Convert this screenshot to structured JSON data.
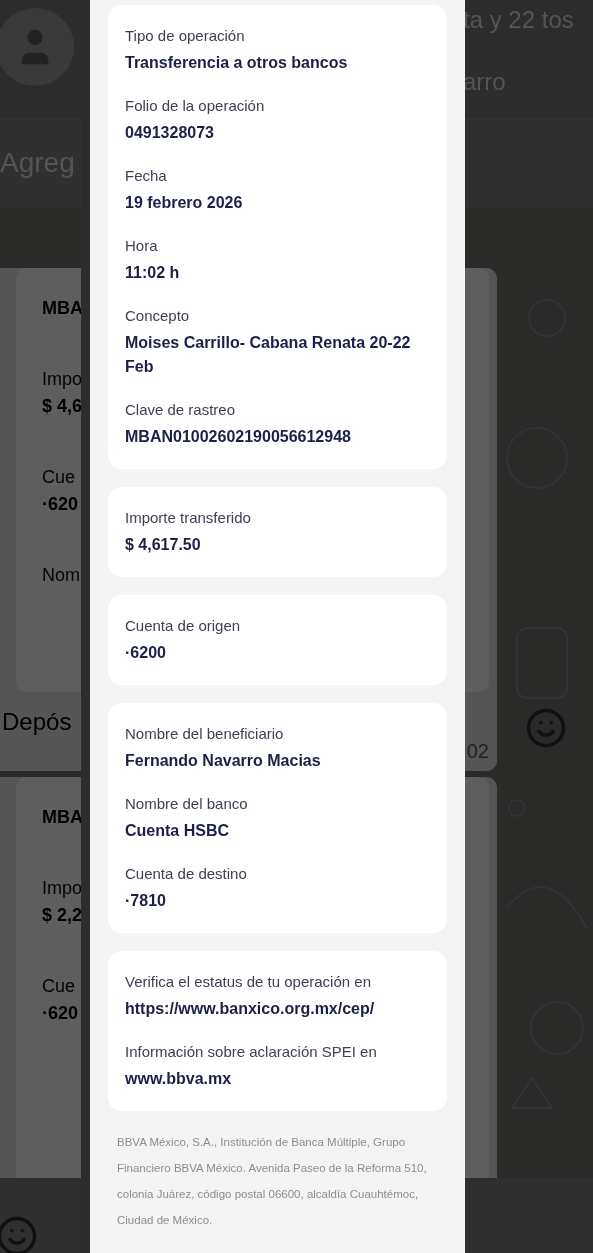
{
  "chat": {
    "header_title": "ta y 22 tos",
    "header_subtitle": "arro",
    "banner_text": "Agreg",
    "messages": [
      {
        "fields": [
          {
            "value": "MBA"
          },
          {
            "label": "Impo",
            "value": "$ 4,6"
          },
          {
            "label": "Cue",
            "value": "·620"
          },
          {
            "label": "Nom"
          }
        ],
        "caption": "Depós",
        "time": "02"
      },
      {
        "fields": [
          {
            "value": "MBA"
          },
          {
            "label": "Impo",
            "value": "$ 2,2"
          },
          {
            "label": "Cue",
            "value": "·620"
          }
        ]
      }
    ]
  },
  "receipt": {
    "cards": [
      {
        "fields": [
          {
            "label": "Tipo de operación",
            "value": "Transferencia a otros bancos"
          },
          {
            "label": "Folio de la operación",
            "value": "0491328073"
          },
          {
            "label": "Fecha",
            "value": "19 febrero 2026"
          },
          {
            "label": "Hora",
            "value": "11:02 h"
          },
          {
            "label": "Concepto",
            "value": "Moises Carrillo- Cabana Renata 20-22 Feb"
          },
          {
            "label": "Clave de rastreo",
            "value": "MBAN01002602190056612948"
          }
        ]
      },
      {
        "fields": [
          {
            "label": "Importe transferido",
            "value": "$ 4,617.50"
          }
        ]
      },
      {
        "fields": [
          {
            "label": "Cuenta de origen",
            "value": "·6200"
          }
        ]
      },
      {
        "fields": [
          {
            "label": "Nombre del beneficiario",
            "value": "Fernando Navarro Macias"
          },
          {
            "label": "Nombre del banco",
            "value": "Cuenta HSBC"
          },
          {
            "label": "Cuenta de destino",
            "value": "·7810"
          }
        ]
      },
      {
        "fields": [
          {
            "label": "Verifica el estatus de tu operación en",
            "value": "https://www.banxico.org.mx/cep/"
          },
          {
            "label": "Información sobre aclaración SPEI en",
            "value": "www.bbva.mx"
          }
        ]
      }
    ],
    "legal": "BBVA México, S.A., Institución de Banca Múltiple, Grupo Financiero BBVA México. Avenida Paseo de la Reforma 510, colonia Juárez, código postal 06600, alcaldía Cuauhtémoc, Ciudad de México."
  }
}
